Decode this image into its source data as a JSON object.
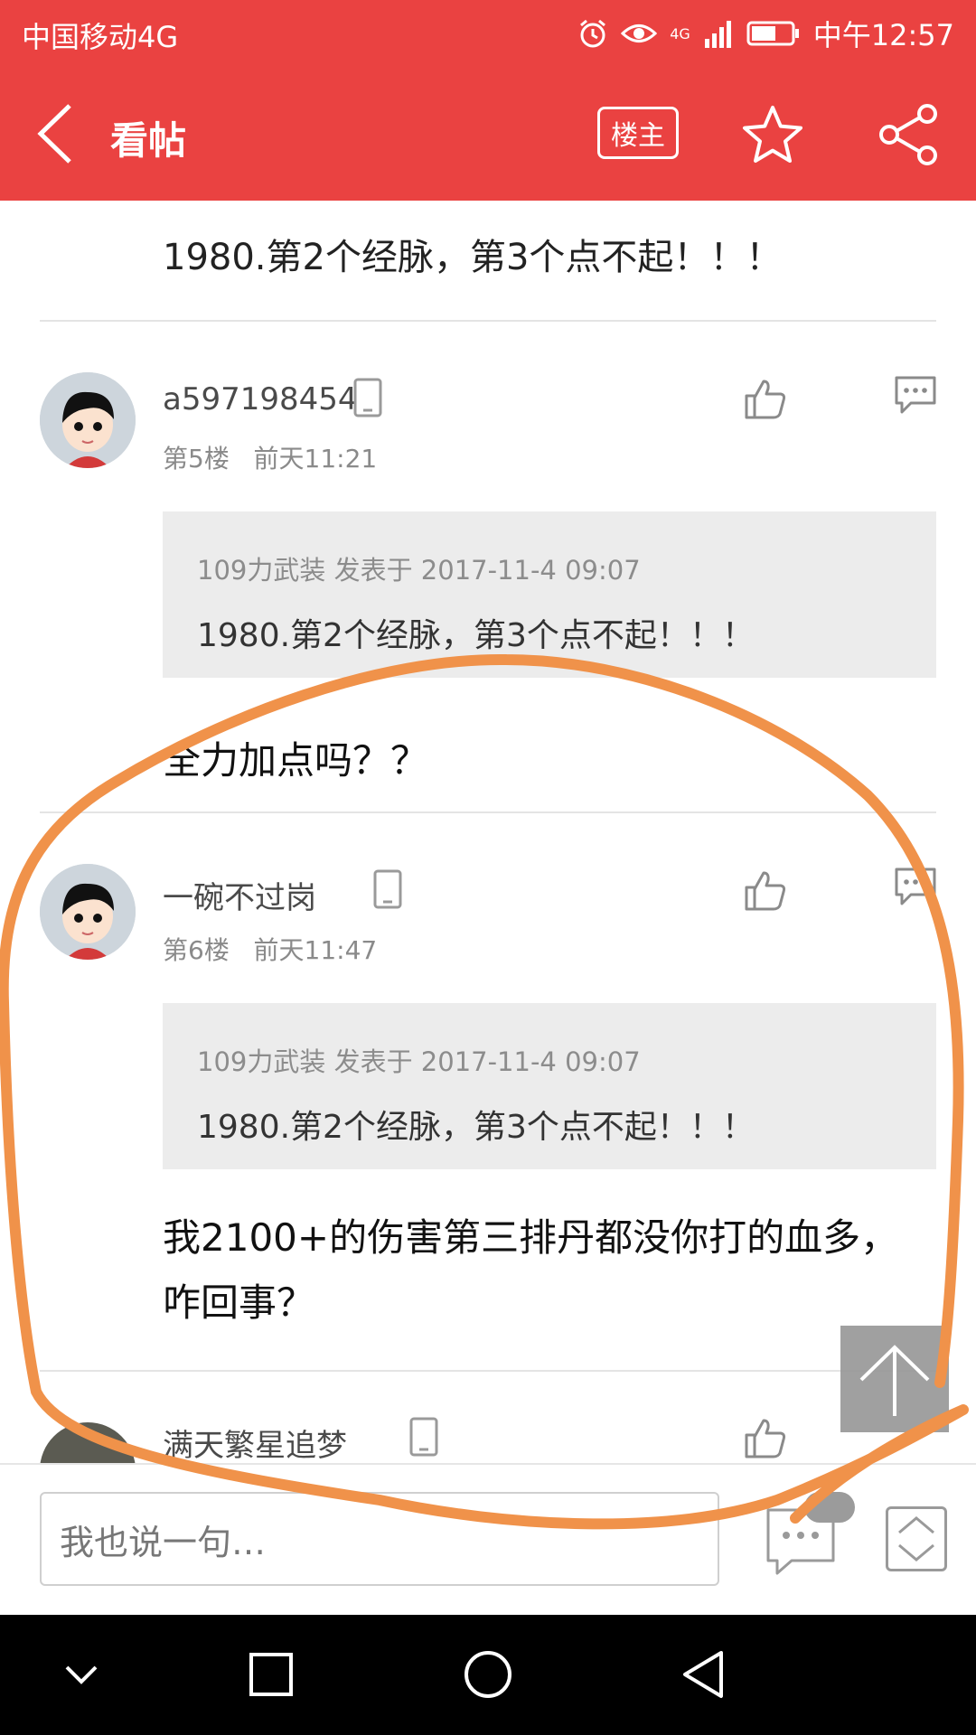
{
  "status_bar": {
    "carrier": "中国移动4G",
    "network_label": "4G",
    "time": "中午12:57"
  },
  "app_bar": {
    "title": "看帖",
    "op_filter_label": "楼主"
  },
  "previous_post": {
    "text": "1980.第2个经脉，第3个点不起！！！"
  },
  "posts": [
    {
      "username": "a597198454",
      "floor": "第5楼",
      "time": "前天11:21",
      "quote_header": "109力武装 发表于 2017-11-4 09:07",
      "quote_text": "1980.第2个经脉，第3个点不起！！！",
      "body": "全力加点吗？？"
    },
    {
      "username": "一碗不过岗",
      "floor": "第6楼",
      "time": "前天11:47",
      "quote_header": "109力武装 发表于 2017-11-4 09:07",
      "quote_text": "1980.第2个经脉，第3个点不起！！！",
      "body": "我2100+的伤害第三排丹都没你打的血多，咋回事？"
    },
    {
      "username": "满天繁星追梦"
    }
  ],
  "input_bar": {
    "placeholder": "我也说一句…"
  },
  "colors": {
    "brand_red": "#ea4241",
    "annotation_orange": "#f0924a"
  }
}
